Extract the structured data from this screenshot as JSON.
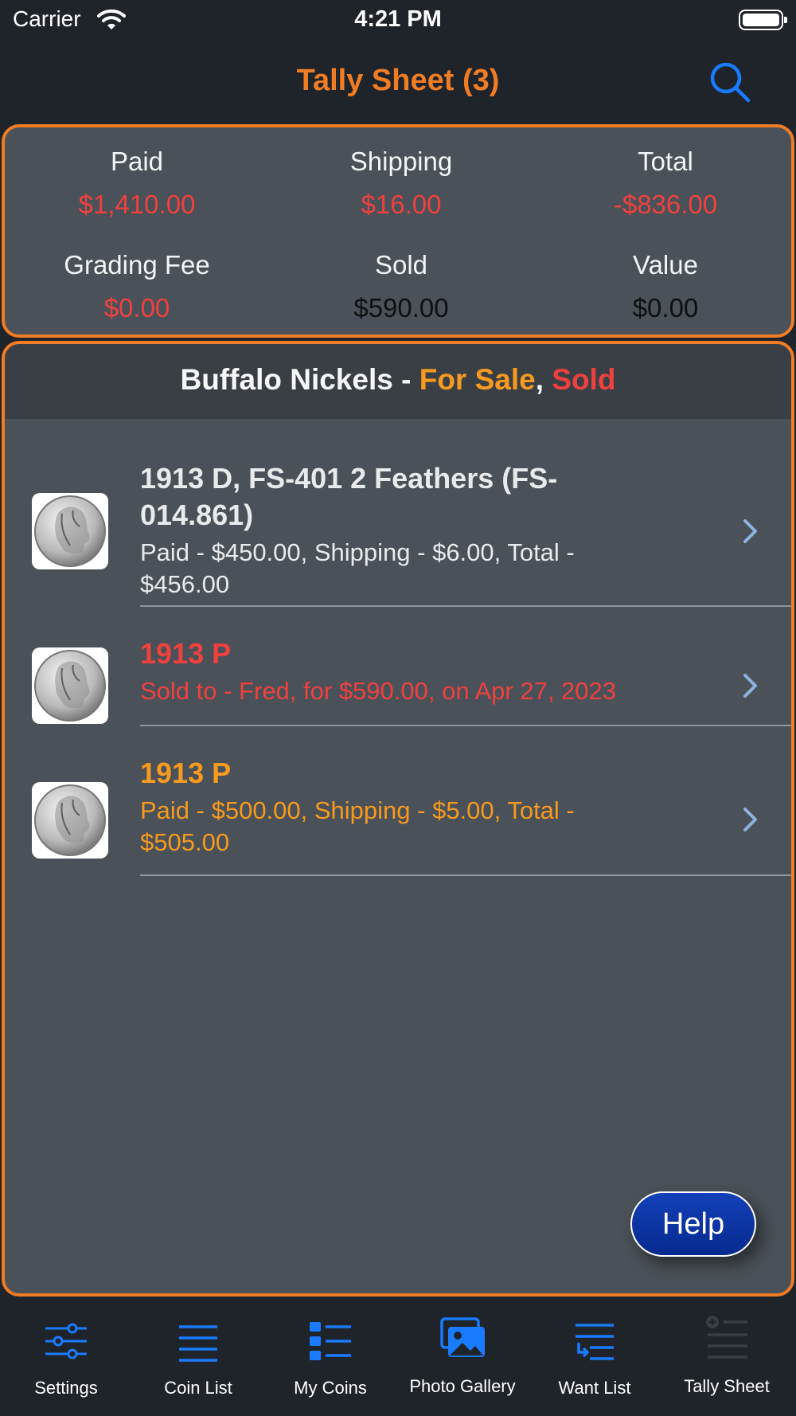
{
  "status": {
    "carrier": "Carrier",
    "time": "4:21 PM"
  },
  "nav": {
    "title": "Tally Sheet (3)"
  },
  "summary": {
    "paid_label": "Paid",
    "paid_value": "$1,410.00",
    "shipping_label": "Shipping",
    "shipping_value": "$16.00",
    "total_label": "Total",
    "total_value": "-$836.00",
    "grading_label": "Grading Fee",
    "grading_value": "$0.00",
    "sold_label": "Sold",
    "sold_value": "$590.00",
    "value_label": "Value",
    "value_value": "$0.00"
  },
  "section": {
    "name": "Buffalo Nickels",
    "dash": " - ",
    "for_sale": "For Sale",
    "comma": ", ",
    "sold": "Sold"
  },
  "items": [
    {
      "title": "1913 D, FS-401 2 Feathers (FS-014.861)",
      "detail": "Paid - $450.00, Shipping - $6.00, Total - $456.00",
      "status": "owned"
    },
    {
      "title": "1913 P",
      "detail": "Sold to - Fred, for $590.00, on Apr 27, 2023",
      "status": "sold"
    },
    {
      "title": "1913 P",
      "detail": "Paid - $500.00, Shipping - $5.00, Total - $505.00",
      "status": "for_sale"
    }
  ],
  "help_label": "Help",
  "tabs": [
    {
      "label": "Settings",
      "icon": "sliders-icon"
    },
    {
      "label": "Coin List",
      "icon": "list-icon"
    },
    {
      "label": "My Coins",
      "icon": "grid-list-icon"
    },
    {
      "label": "Photo Gallery",
      "icon": "photos-icon"
    },
    {
      "label": "Want List",
      "icon": "want-list-icon"
    },
    {
      "label": "Tally Sheet",
      "icon": "tally-icon"
    }
  ],
  "colors": {
    "accent": "#f07c24",
    "link_blue": "#1a7bff",
    "sold_red": "#f0413f",
    "for_sale_orange": "#f79a1e",
    "panel": "#4a5158",
    "background": "#1f232a"
  }
}
